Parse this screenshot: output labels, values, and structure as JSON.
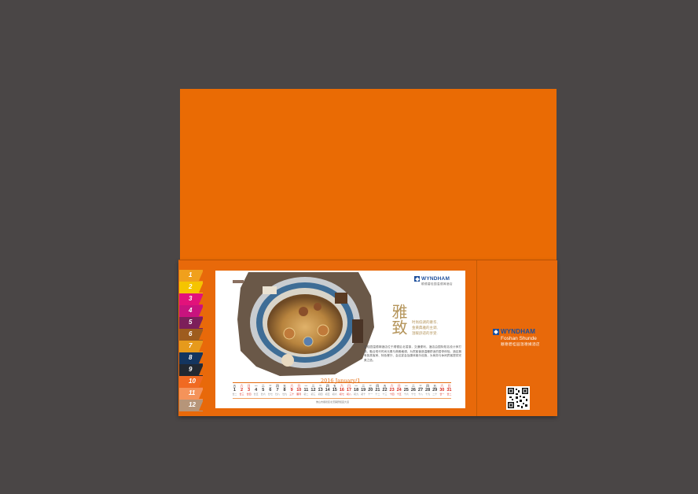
{
  "brand": {
    "name": "WYNDHAM",
    "location": "Foshan Shunde",
    "chinese_name": "顺德碧桂园温德姆酒店",
    "accent": "#1d4f9c"
  },
  "folder": {
    "color": "#ea6b04"
  },
  "month_tabs": [
    {
      "label": "1",
      "color": "#f0a01c"
    },
    {
      "label": "2",
      "color": "#f5c400"
    },
    {
      "label": "3",
      "color": "#e2127b"
    },
    {
      "label": "4",
      "color": "#c8137e"
    },
    {
      "label": "5",
      "color": "#7c1f5a"
    },
    {
      "label": "6",
      "color": "#9e5c1e"
    },
    {
      "label": "7",
      "color": "#e69a1c"
    },
    {
      "label": "8",
      "color": "#14355f"
    },
    {
      "label": "9",
      "color": "#222831"
    },
    {
      "label": "10",
      "color": "#f06a22"
    },
    {
      "label": "11",
      "color": "#f4935a"
    },
    {
      "label": "12",
      "color": "#b69579"
    }
  ],
  "card": {
    "headline": "雅致",
    "poem": [
      "时尚低调的奢华,",
      "金黄典雅的主调,",
      "温暖舒适的享受."
    ],
    "description": "碧桂园温德姆酒店位于顺德区北滘镇，交通便利，酒店由国际知名设计师打造，融合现代时尚元素与典雅格调，为宾客营造温暖舒适的居停体验。酒店拥有各类客房、特色餐厅、会议宴会及康体娱乐设施，为商务与休闲宾客提供完美之选。",
    "calendar_title": "2016 January/1",
    "weekdays": [
      "五",
      "六",
      "日",
      "一",
      "二",
      "三",
      "四",
      "五",
      "六",
      "日",
      "一",
      "二",
      "三",
      "四",
      "五",
      "六",
      "日",
      "一",
      "二",
      "三",
      "四",
      "五",
      "六",
      "日",
      "一",
      "二",
      "三",
      "四",
      "五",
      "六",
      "日"
    ],
    "days": [
      "1",
      "2",
      "3",
      "4",
      "5",
      "6",
      "7",
      "8",
      "9",
      "10",
      "11",
      "12",
      "13",
      "14",
      "15",
      "16",
      "17",
      "18",
      "19",
      "20",
      "21",
      "22",
      "23",
      "24",
      "25",
      "26",
      "27",
      "28",
      "29",
      "30",
      "31"
    ],
    "lunar": [
      "廿二",
      "廿三",
      "廿四",
      "廿五",
      "廿六",
      "廿七",
      "廿八",
      "廿九",
      "三十",
      "腊月",
      "初二",
      "初三",
      "初四",
      "初五",
      "初六",
      "初七",
      "初八",
      "初九",
      "初十",
      "十一",
      "十二",
      "十三",
      "十四",
      "十五",
      "十六",
      "十七",
      "十八",
      "十九",
      "二十",
      "廿一",
      "廿二"
    ],
    "footer": "佛山市顺德区北滘镇碧桂园大道"
  }
}
